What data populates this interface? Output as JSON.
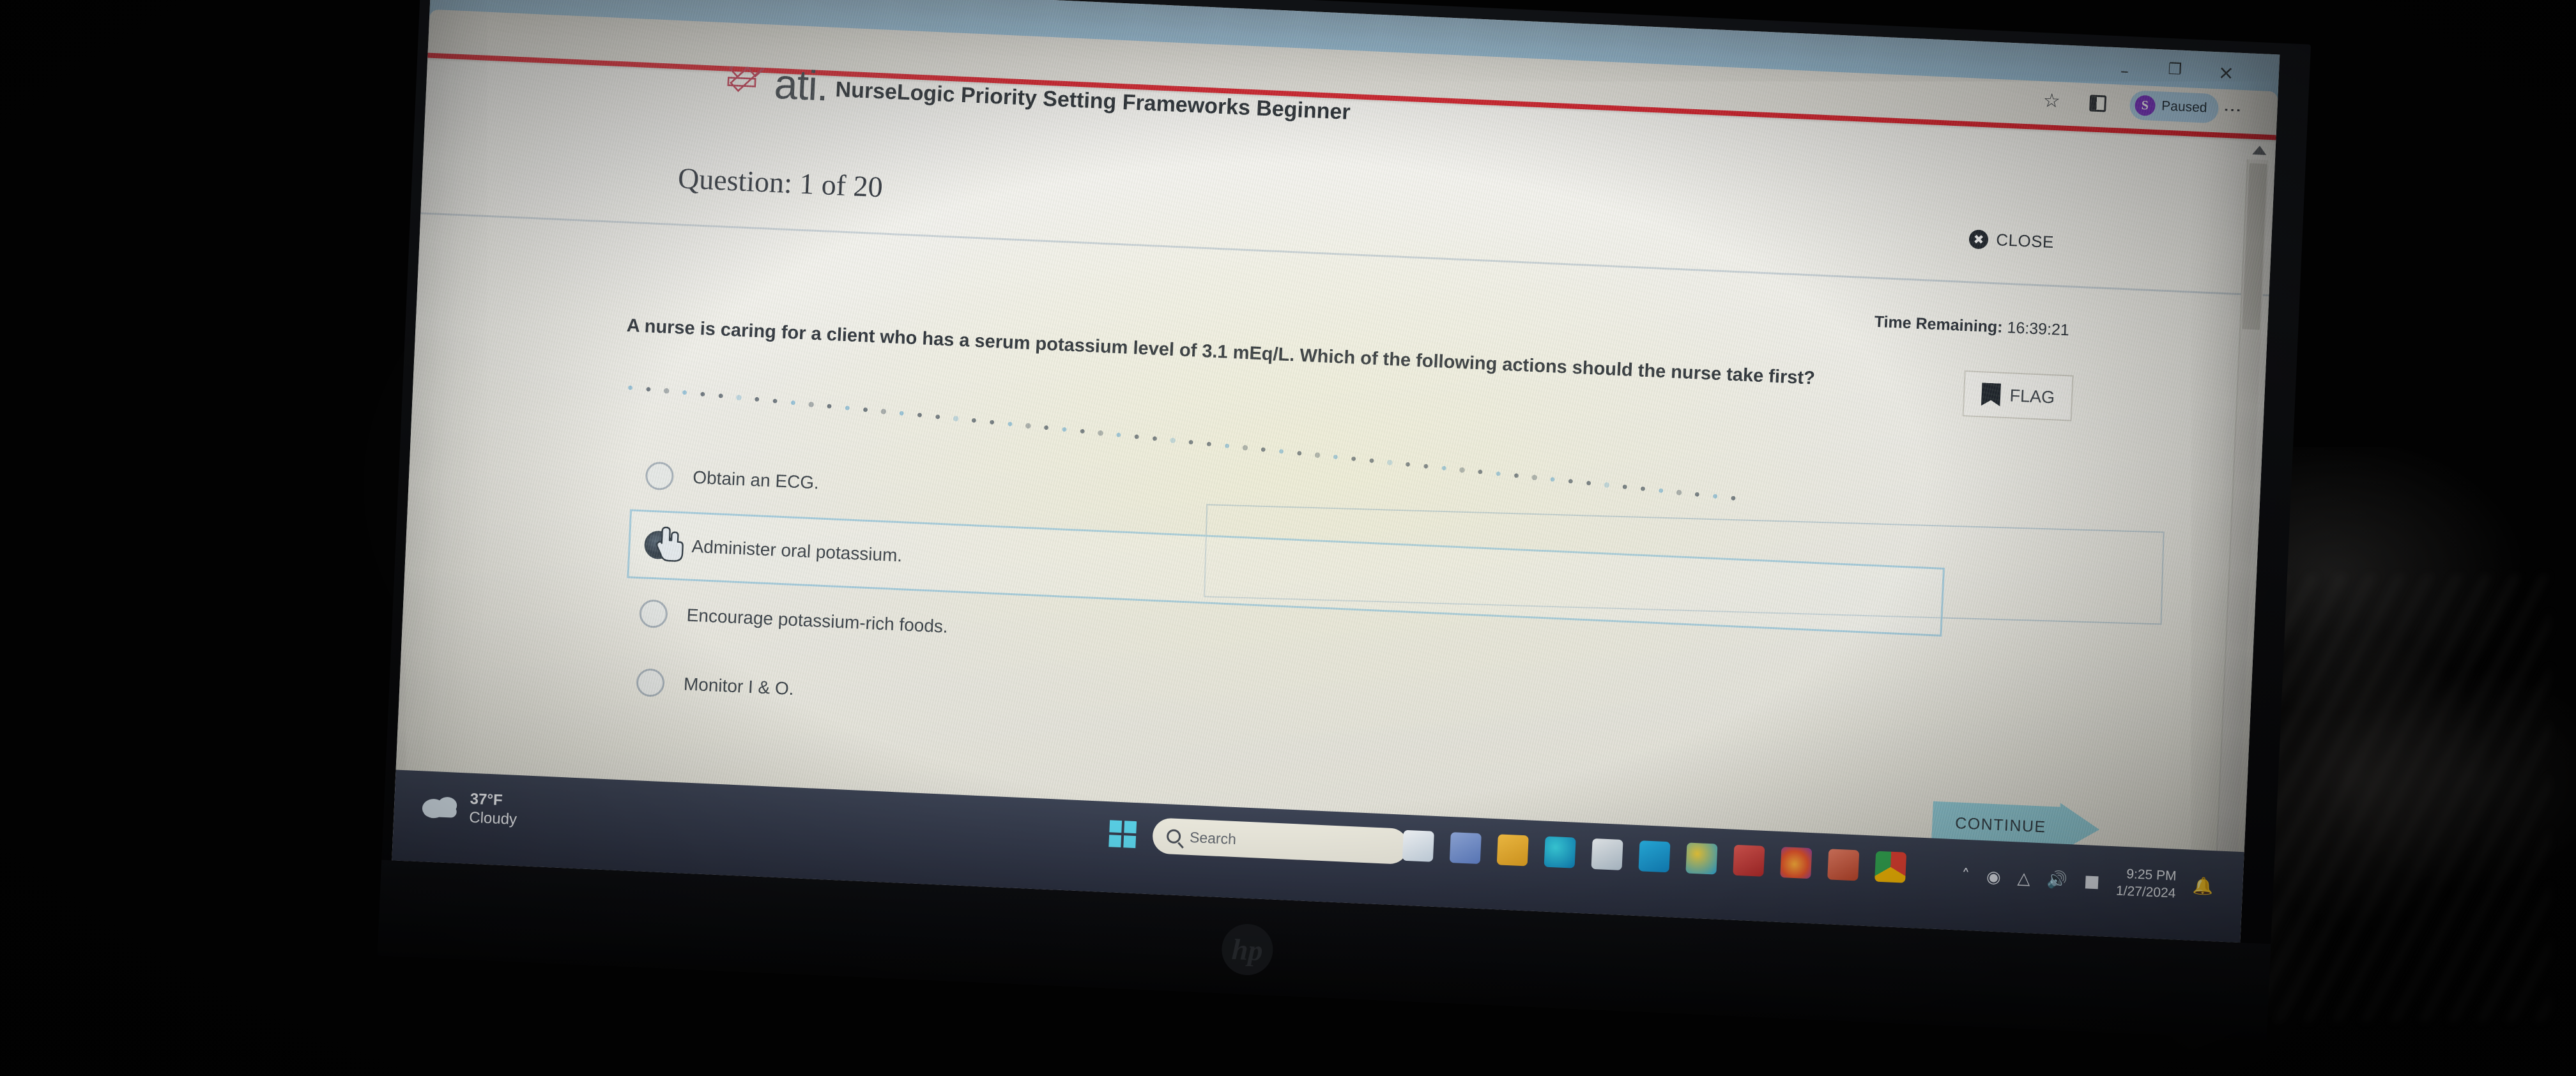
{
  "browser": {
    "window_controls": {
      "minimize": "–",
      "maximize": "❐",
      "close": "×"
    },
    "star_icon": "☆",
    "menu_icon": "⋮",
    "profile": {
      "initial": "S",
      "label": "Paused"
    }
  },
  "app": {
    "brand": "ati.",
    "course_title": "NurseLogic Priority Setting Frameworks Beginner",
    "question_counter": "Question: 1 of 20",
    "close_label": "CLOSE",
    "time_remaining_label": "Time Remaining:",
    "time_remaining_value": "16:39:21",
    "flag_label": "FLAG",
    "continue_label": "CONTINUE",
    "question_text": "A nurse is caring for a client who has a serum potassium level of 3.1 mEq/L. Which of the following actions should the nurse take first?",
    "options": [
      {
        "label": "Obtain an ECG.",
        "selected": false
      },
      {
        "label": "Administer oral potassium.",
        "selected": true
      },
      {
        "label": "Encourage potassium-rich foods.",
        "selected": false
      },
      {
        "label": "Monitor I & O.",
        "selected": false
      }
    ],
    "accent_red": "#d81f2a",
    "accent_teal": "#93d0dc"
  },
  "taskbar": {
    "weather": {
      "temperature": "37°F",
      "condition": "Cloudy"
    },
    "search_placeholder": "Search",
    "tray": {
      "chevron": "˄",
      "clock_time": "9:25 PM",
      "clock_date": "1/27/2024",
      "bell": "🔔"
    }
  },
  "device": {
    "brand": "hp"
  }
}
